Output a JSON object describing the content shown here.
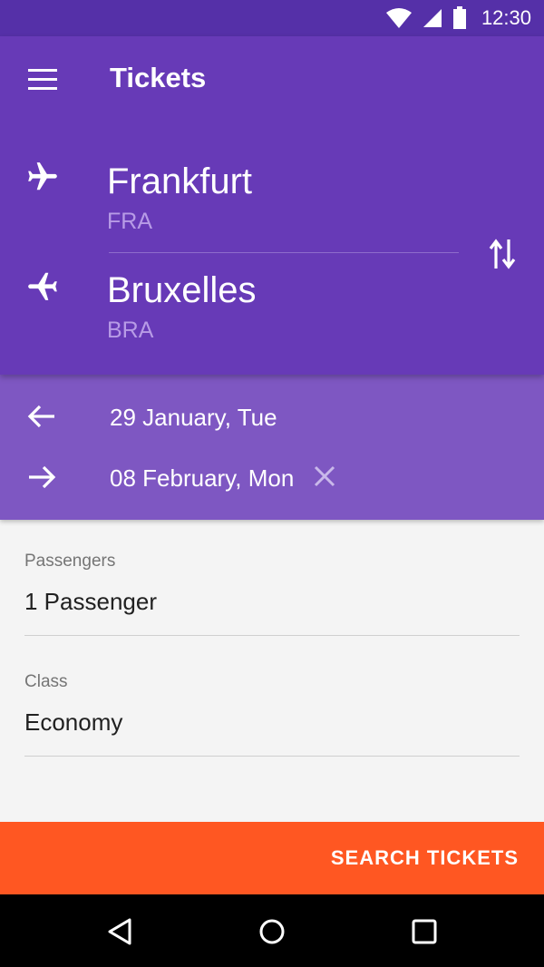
{
  "status_bar": {
    "time": "12:30",
    "icons": [
      "wifi-icon",
      "signal-icon",
      "battery-icon"
    ]
  },
  "toolbar": {
    "title": "Tickets",
    "menu_icon": "menu-icon"
  },
  "route": {
    "origin": {
      "city": "Frankfurt",
      "code": "FRA",
      "icon": "takeoff-plane-icon"
    },
    "destination": {
      "city": "Bruxelles",
      "code": "BRA",
      "icon": "landing-plane-icon"
    },
    "swap_icon": "swap-icon"
  },
  "dates": {
    "departure": {
      "label": "29 January, Tue",
      "icon": "arrow-left-icon"
    },
    "return": {
      "label": "08 February, Mon",
      "icon": "arrow-right-icon",
      "clear_icon": "close-icon"
    }
  },
  "form": {
    "passengers": {
      "label": "Passengers",
      "value": "1 Passenger"
    },
    "class": {
      "label": "Class",
      "value": "Economy"
    }
  },
  "actions": {
    "search_label": "SEARCH TICKETS"
  },
  "nav_bar": {
    "icons": [
      "back-icon",
      "home-icon",
      "recents-icon"
    ]
  },
  "colors": {
    "status_bar": "#5530a8",
    "primary": "#673ab7",
    "primary_light": "#7e57c2",
    "accent": "#ff5722",
    "background": "#f4f4f4"
  }
}
